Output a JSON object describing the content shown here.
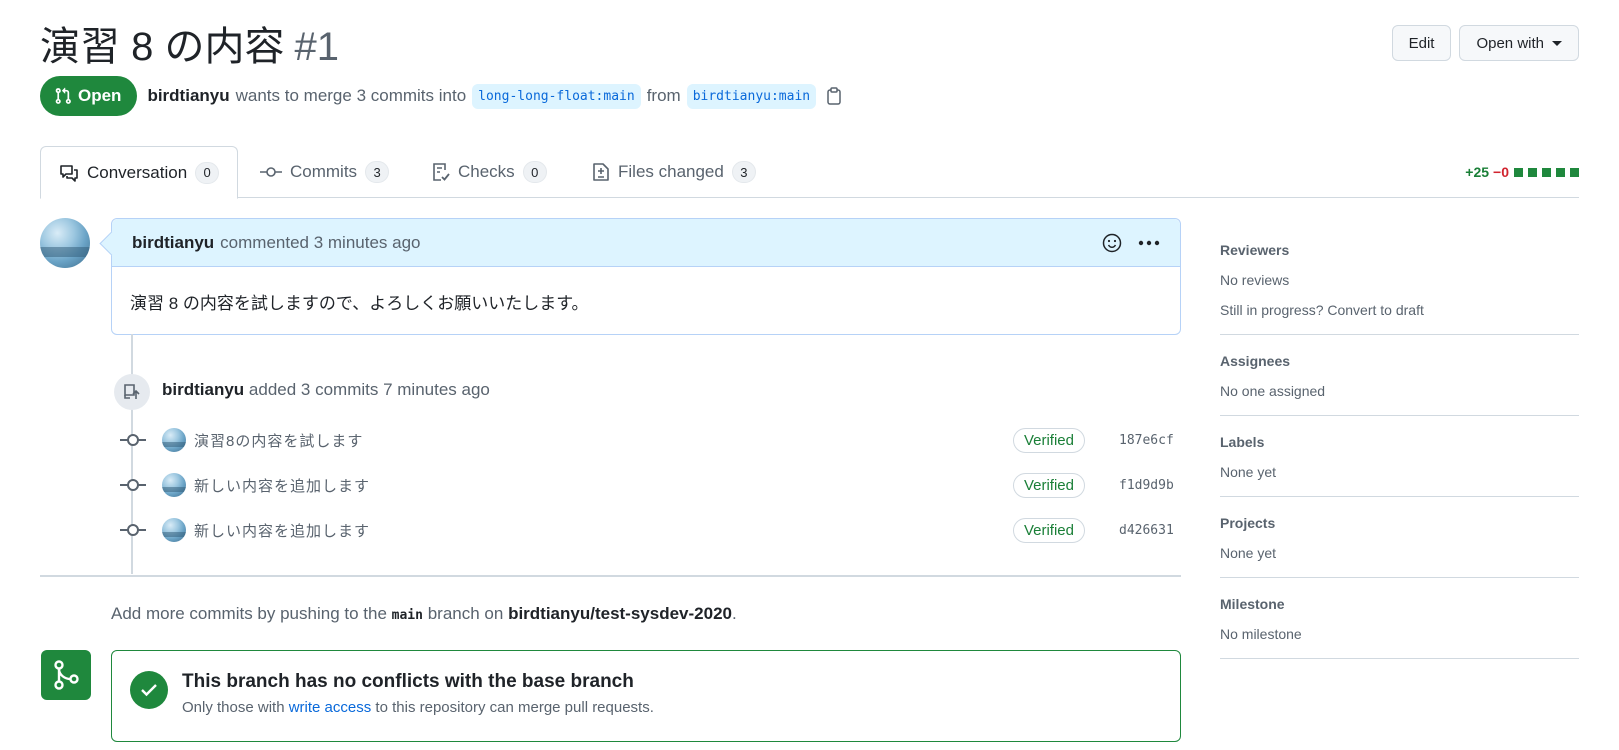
{
  "header": {
    "title": "演習 8 の内容",
    "number": "#1",
    "edit_label": "Edit",
    "open_with_label": "Open with"
  },
  "status": {
    "state": "Open",
    "author": "birdtianyu",
    "action_text": "wants to merge 3 commits into",
    "base_branch": "long-long-float:main",
    "from_text": "from",
    "head_branch": "birdtianyu:main"
  },
  "tabs": [
    {
      "label": "Conversation",
      "count": "0"
    },
    {
      "label": "Commits",
      "count": "3"
    },
    {
      "label": "Checks",
      "count": "0"
    },
    {
      "label": "Files changed",
      "count": "3"
    }
  ],
  "diffstat": {
    "additions": "+25",
    "deletions": "−0"
  },
  "comment": {
    "author": "birdtianyu",
    "meta": "commented 3 minutes ago",
    "body": "演習 8 の内容を試しますので、よろしくお願いいたします。"
  },
  "push_event": {
    "author": "birdtianyu",
    "text": "added 3 commits 7 minutes ago"
  },
  "commits": [
    {
      "message": "演習8の内容を試します",
      "badge": "Verified",
      "sha": "187e6cf"
    },
    {
      "message": "新しい内容を追加します",
      "badge": "Verified",
      "sha": "f1d9d9b"
    },
    {
      "message": "新しい内容を追加します",
      "badge": "Verified",
      "sha": "d426631"
    }
  ],
  "hint": {
    "prefix": "Add more commits by pushing to the",
    "branch": "main",
    "middle": "branch on",
    "repo": "birdtianyu/test-sysdev-2020",
    "suffix": "."
  },
  "merge": {
    "title": "This branch has no conflicts with the base branch",
    "sub_prefix": "Only those with",
    "sub_link": "write access",
    "sub_suffix": "to this repository can merge pull requests."
  },
  "sidebar": {
    "reviewers": {
      "heading": "Reviewers",
      "value": "No reviews",
      "extra": "Still in progress? Convert to draft"
    },
    "assignees": {
      "heading": "Assignees",
      "value": "No one assigned"
    },
    "labels": {
      "heading": "Labels",
      "value": "None yet"
    },
    "projects": {
      "heading": "Projects",
      "value": "None yet"
    },
    "milestone": {
      "heading": "Milestone",
      "value": "No milestone"
    }
  },
  "colors": {
    "open_green": "#1f883d",
    "link_blue": "#0969da",
    "comment_header_bg": "#ddf4ff"
  },
  "icons": [
    "git-pull-request-icon",
    "copy-icon",
    "comment-discussion-icon",
    "git-commit-icon",
    "checklist-icon",
    "file-diff-icon",
    "smiley-icon",
    "kebab-horizontal-icon",
    "repo-push-icon",
    "git-merge-icon",
    "check-icon"
  ]
}
